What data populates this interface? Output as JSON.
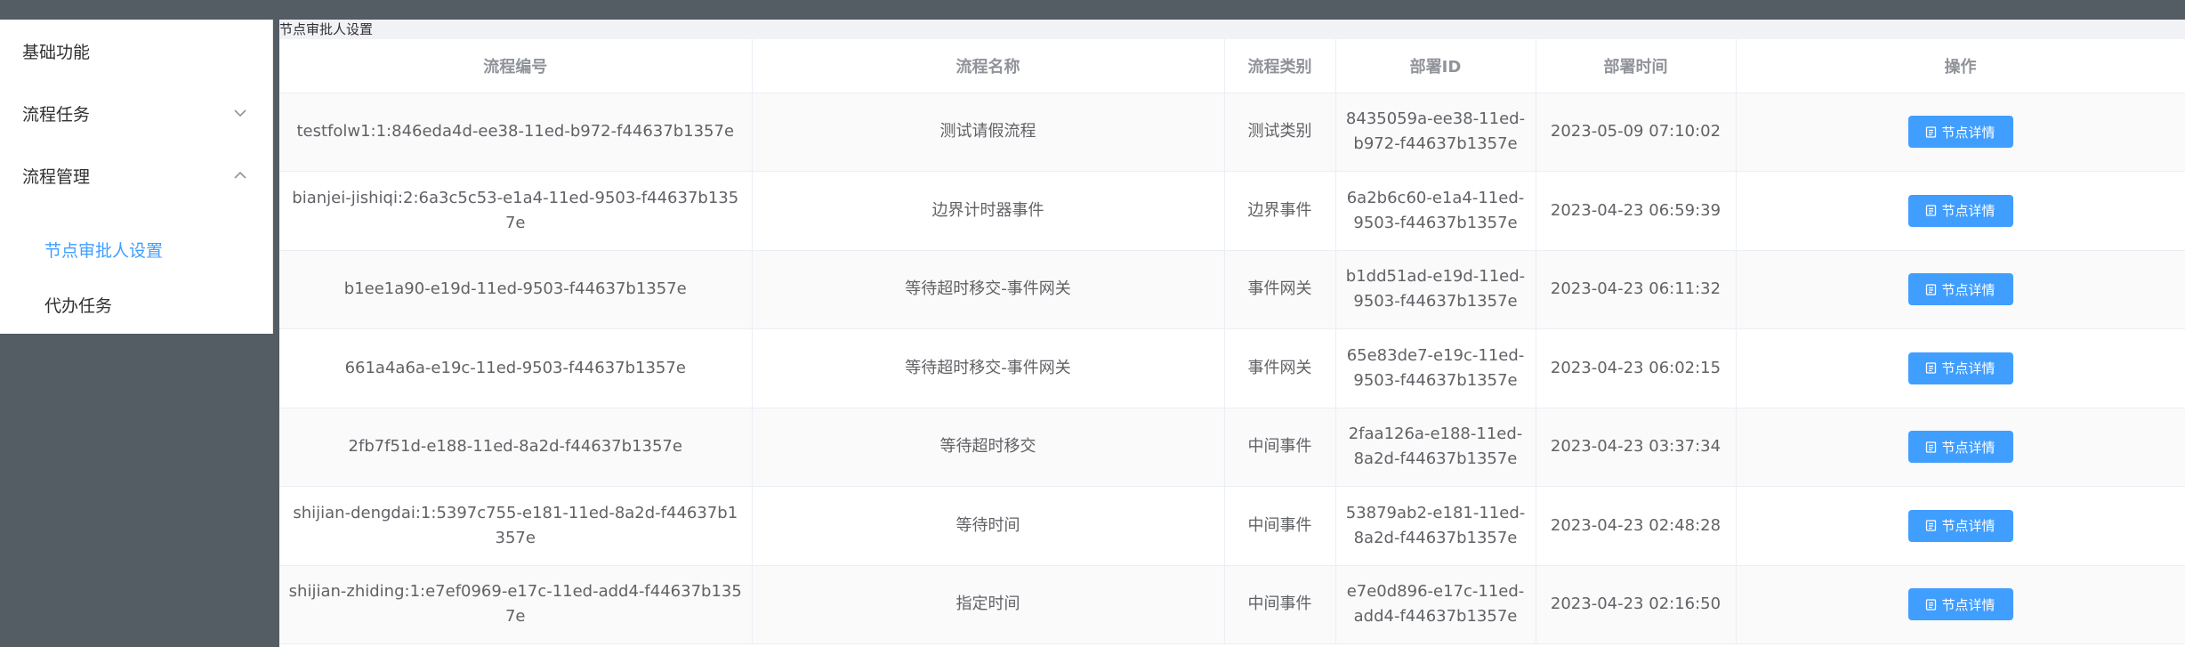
{
  "sidebar": {
    "items": [
      {
        "label": "基础功能"
      },
      {
        "label": "流程任务"
      },
      {
        "label": "流程管理"
      }
    ],
    "subitems": [
      {
        "label": "节点审批人设置",
        "active": true
      },
      {
        "label": "代办任务",
        "active": false
      }
    ]
  },
  "breadcrumb": {
    "title": "节点审批人设置"
  },
  "table": {
    "headers": [
      "流程编号",
      "流程名称",
      "流程类别",
      "部署ID",
      "部署时间",
      "操作"
    ],
    "button_label": "节点详情",
    "rows": [
      {
        "id": "testfolw1:1:846eda4d-ee38-11ed-b972-f44637b1357e",
        "name": "测试请假流程",
        "category": "测试类别",
        "deploy_id": "8435059a-ee38-11ed-b972-f44637b1357e",
        "time": "2023-05-09 07:10:02"
      },
      {
        "id": "bianjei-jishiqi:2:6a3c5c53-e1a4-11ed-9503-f44637b1357e",
        "name": "边界计时器事件",
        "category": "边界事件",
        "deploy_id": "6a2b6c60-e1a4-11ed-9503-f44637b1357e",
        "time": "2023-04-23 06:59:39"
      },
      {
        "id": "b1ee1a90-e19d-11ed-9503-f44637b1357e",
        "name": "等待超时移交-事件网关",
        "category": "事件网关",
        "deploy_id": "b1dd51ad-e19d-11ed-9503-f44637b1357e",
        "time": "2023-04-23 06:11:32"
      },
      {
        "id": "661a4a6a-e19c-11ed-9503-f44637b1357e",
        "name": "等待超时移交-事件网关",
        "category": "事件网关",
        "deploy_id": "65e83de7-e19c-11ed-9503-f44637b1357e",
        "time": "2023-04-23 06:02:15"
      },
      {
        "id": "2fb7f51d-e188-11ed-8a2d-f44637b1357e",
        "name": "等待超时移交",
        "category": "中间事件",
        "deploy_id": "2faa126a-e188-11ed-8a2d-f44637b1357e",
        "time": "2023-04-23 03:37:34"
      },
      {
        "id": "shijian-dengdai:1:5397c755-e181-11ed-8a2d-f44637b1357e",
        "name": "等待时间",
        "category": "中间事件",
        "deploy_id": "53879ab2-e181-11ed-8a2d-f44637b1357e",
        "time": "2023-04-23 02:48:28"
      },
      {
        "id": "shijian-zhiding:1:e7ef0969-e17c-11ed-add4-f44637b1357e",
        "name": "指定时间",
        "category": "中间事件",
        "deploy_id": "e7e0d896-e17c-11ed-add4-f44637b1357e",
        "time": "2023-04-23 02:16:50"
      }
    ]
  },
  "colors": {
    "accent": "#409eff",
    "sidebar_bg": "#ffffff",
    "page_bg": "#545c64"
  }
}
